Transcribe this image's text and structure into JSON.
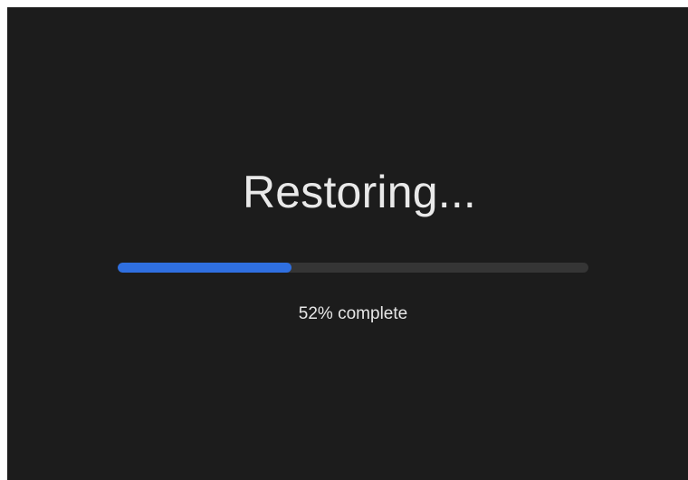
{
  "screen": {
    "title": "Restoring...",
    "status_text": "52% complete",
    "progress_fraction": 0.37,
    "colors": {
      "background": "#1c1c1c",
      "progress_track": "#353535",
      "progress_fill": "#2f6fe0",
      "text": "#e9e9e9"
    }
  }
}
